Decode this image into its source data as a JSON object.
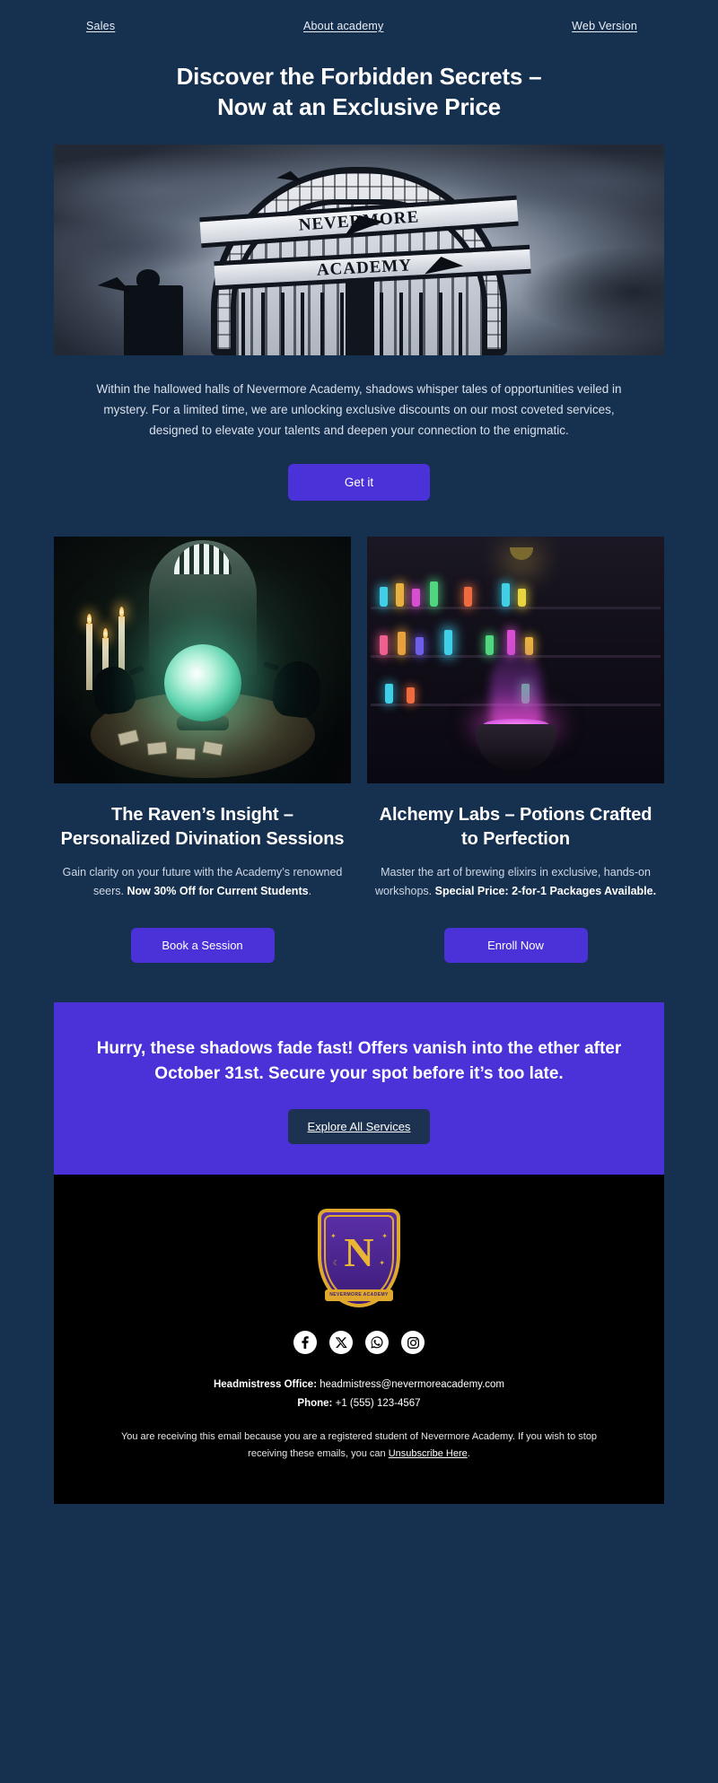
{
  "preheader": {
    "links": [
      {
        "label": "Sales"
      },
      {
        "label": "About academy"
      },
      {
        "label": "Web Version"
      }
    ]
  },
  "hero": {
    "headline_line1": "Discover the Forbidden Secrets –",
    "headline_line2": "Now at an Exclusive Price",
    "image_alt": "nevermore-academy-gate",
    "gate_text_top": "NEVERMORE",
    "gate_text_bottom": "ACADEMY",
    "intro": "Within the hallowed halls of Nevermore Academy, shadows whisper tales of opportunities veiled in mystery. For a limited time, we are unlocking exclusive discounts on our most coveted services, designed to elevate your talents and deepen your connection to the enigmatic.",
    "cta_label": "Get it"
  },
  "cards": [
    {
      "image_alt": "crystal-ball-ravens",
      "title": "The Raven’s Insight – Personalized Divination Sessions",
      "desc_plain": "Gain clarity on your future with the Academy’s renowned seers. ",
      "desc_bold": "Now 30% Off for Current Students",
      "desc_tail": ".",
      "cta_label": "Book a Session"
    },
    {
      "image_alt": "alchemy-lab-cauldron",
      "title": "Alchemy Labs – Potions Crafted to Perfection",
      "desc_plain": "Master the art of brewing elixirs in exclusive, hands-on workshops. ",
      "desc_bold": "Special Price: 2-for-1 Packages Available.",
      "desc_tail": "",
      "cta_label": "Enroll Now"
    }
  ],
  "banner": {
    "text": "Hurry, these shadows fade fast! Offers vanish into the ether after October 31st. Secure your spot before it’s too late.",
    "cta_label": "Explore All Services"
  },
  "footer": {
    "logo_letter": "N",
    "logo_ribbon": "NEVERMORE ACADEMY",
    "socials": [
      {
        "name": "facebook-icon"
      },
      {
        "name": "x-twitter-icon"
      },
      {
        "name": "whatsapp-icon"
      },
      {
        "name": "instagram-icon"
      }
    ],
    "office_label": "Headmistress Office:",
    "office_email": " headmistress@nevermoreacademy.com",
    "phone_label": "Phone:",
    "phone_value": " +1 (555) 123-4567",
    "legal_pre": "You are receiving this email because you are a registered student of Nevermore Academy. If you wish to stop receiving these emails, you can ",
    "legal_link": "Unsubscribe Here",
    "legal_post": "."
  },
  "colors": {
    "background": "#16304f",
    "accent_purple": "#4a31d8",
    "footer_bg": "#000000",
    "crest_gold": "#e0a92e"
  }
}
